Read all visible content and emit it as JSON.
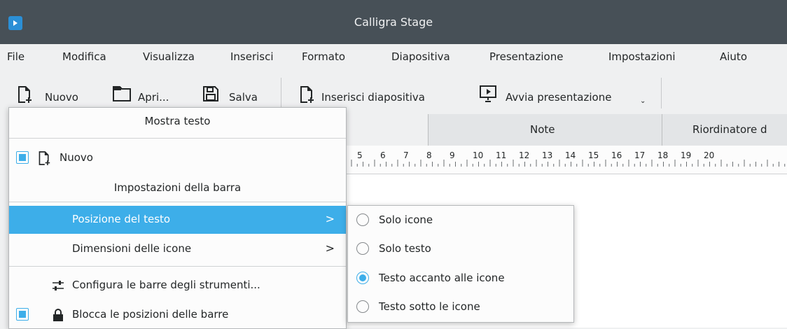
{
  "window": {
    "title": "Calligra Stage"
  },
  "menubar": {
    "items": [
      "File",
      "Modifica",
      "Visualizza",
      "Inserisci",
      "Formato",
      "Diapositiva",
      "Presentazione",
      "Impostazioni",
      "Aiuto"
    ]
  },
  "toolbar": {
    "new_label": "Nuovo",
    "open_label": "Apri...",
    "save_label": "Salva",
    "insert_slide_label": "Inserisci diapositiva",
    "start_presentation_label": "Avvia presentazione"
  },
  "tabs": {
    "notes": "Note",
    "sorter": "Riordinatore d"
  },
  "ruler": {
    "numbers": [
      "5",
      "6",
      "7",
      "8",
      "9",
      "10",
      "11",
      "12",
      "13",
      "14",
      "15",
      "16",
      "17",
      "18",
      "19",
      "20"
    ]
  },
  "context_menu": {
    "header": "Mostra testo",
    "new_item": "Nuovo",
    "new_checked": true,
    "toolbar_settings_title": "Impostazioni della barra",
    "text_position": "Posizione del testo",
    "icon_size": "Dimensioni delle icone",
    "configure_toolbars": "Configura le barre degli strumenti...",
    "lock_toolbars": "Blocca le posizioni delle barre",
    "lock_checked": true
  },
  "submenu": {
    "options": [
      "Solo icone",
      "Solo testo",
      "Testo accanto alle icone",
      "Testo sotto le icone"
    ],
    "selected": "Testo accanto alle icone"
  },
  "colors": {
    "accent": "#3daee9",
    "titlebar": "#475057",
    "background": "#eff0f1"
  }
}
